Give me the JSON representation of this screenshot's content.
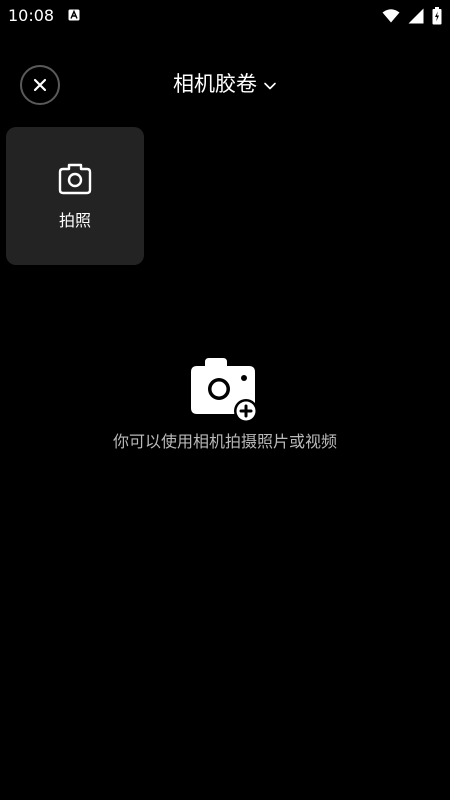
{
  "status_bar": {
    "time": "10:08",
    "notification_icon": "a-badge-icon",
    "icons": [
      "wifi-icon",
      "signal-icon",
      "battery-icon"
    ]
  },
  "header": {
    "title": "相机胶卷",
    "close_icon": "close-icon",
    "dropdown_icon": "chevron-down-icon"
  },
  "capture_tile": {
    "label": "拍照",
    "icon": "camera-icon"
  },
  "empty_state": {
    "icon": "camera-add-icon",
    "message": "你可以使用相机拍摄照片或视频"
  },
  "colors": {
    "background": "#000000",
    "tile": "#232323",
    "muted_text": "#b9b9b9"
  }
}
